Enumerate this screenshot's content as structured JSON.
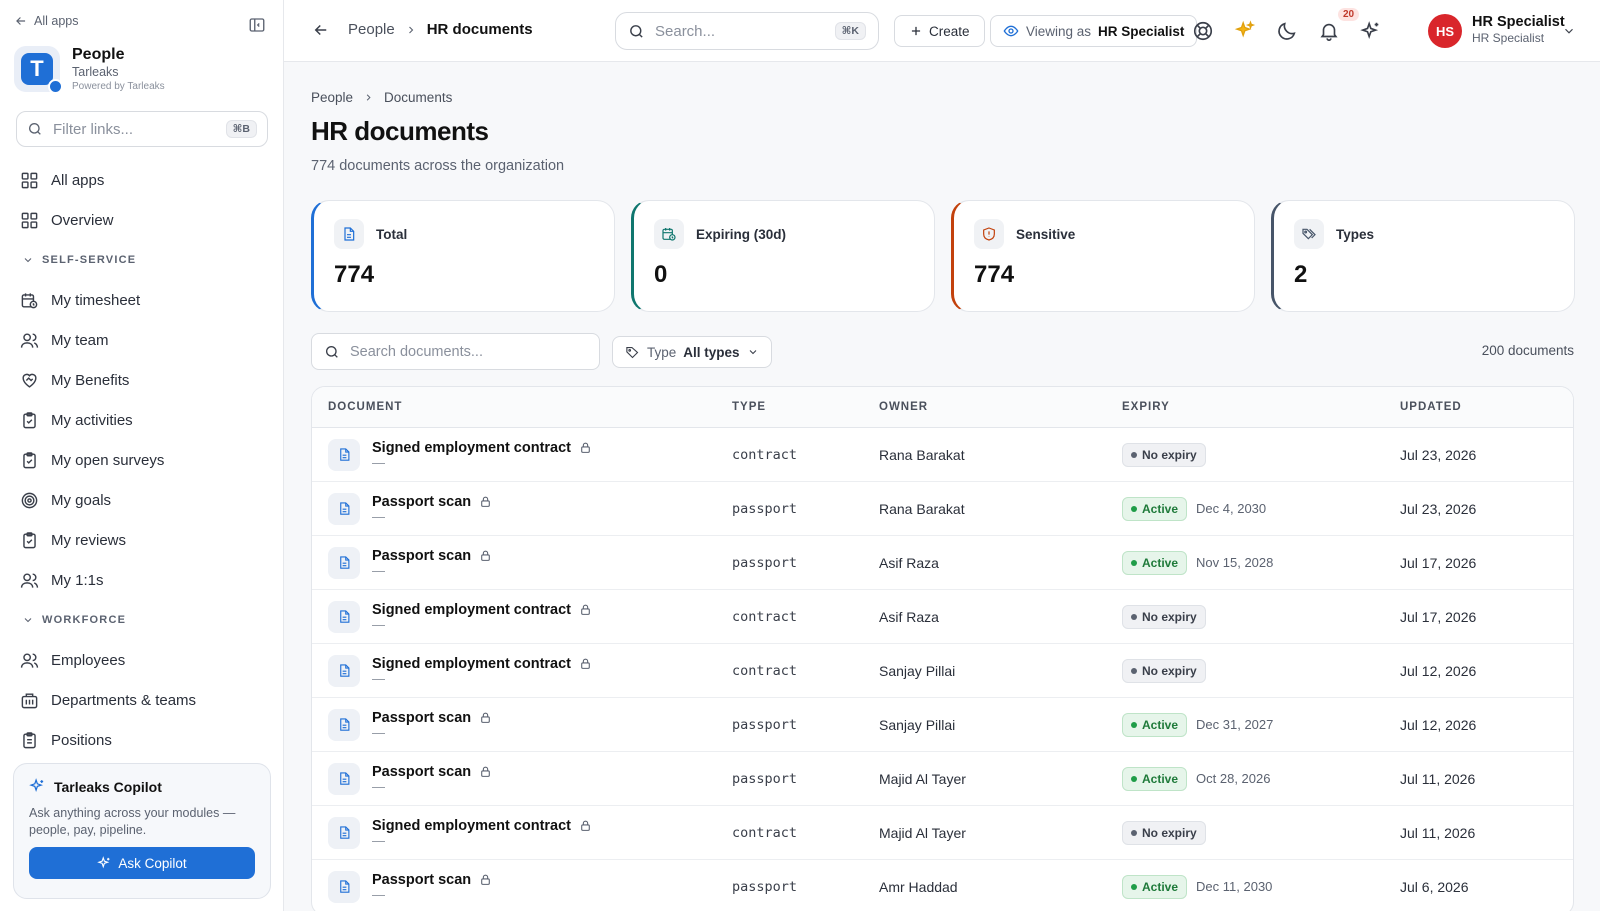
{
  "sidebar": {
    "back_label": "All apps",
    "brand": {
      "name": "People",
      "org": "Tarleaks",
      "powered": "Powered by Tarleaks",
      "logo_letter": "T"
    },
    "filter": {
      "placeholder": "Filter links...",
      "shortcut": "⌘B"
    },
    "top_items": [
      {
        "label": "All apps",
        "icon": "grid-icon"
      },
      {
        "label": "Overview",
        "icon": "grid-icon"
      }
    ],
    "sections": [
      {
        "title": "SELF-SERVICE",
        "items": [
          {
            "label": "My timesheet",
            "icon": "calendar-clock-icon"
          },
          {
            "label": "My team",
            "icon": "users-icon"
          },
          {
            "label": "My Benefits",
            "icon": "heart-handshake-icon"
          },
          {
            "label": "My activities",
            "icon": "clipboard-check-icon"
          },
          {
            "label": "My open surveys",
            "icon": "clipboard-check-icon"
          },
          {
            "label": "My goals",
            "icon": "target-icon"
          },
          {
            "label": "My reviews",
            "icon": "clipboard-check-icon"
          },
          {
            "label": "My 1:1s",
            "icon": "users-icon"
          }
        ]
      },
      {
        "title": "WORKFORCE",
        "items": [
          {
            "label": "Employees",
            "icon": "users-icon"
          },
          {
            "label": "Departments & teams",
            "icon": "building-icon"
          },
          {
            "label": "Positions",
            "icon": "clipboard-list-icon"
          }
        ]
      }
    ],
    "copilot": {
      "title": "Tarleaks Copilot",
      "description": "Ask anything across your modules — people, pay, pipeline.",
      "button": "Ask Copilot"
    }
  },
  "header": {
    "breadcrumb": [
      "People",
      "HR documents"
    ],
    "search": {
      "placeholder": "Search...",
      "shortcut": "⌘K"
    },
    "create_label": "Create",
    "viewing_prefix": "Viewing as",
    "viewing_role": "HR Specialist",
    "notifications_count": "20",
    "user": {
      "initials": "HS",
      "name": "HR Specialist",
      "role": "HR Specialist"
    }
  },
  "page": {
    "breadcrumb": [
      "People",
      "Documents"
    ],
    "title": "HR documents",
    "subtitle": "774 documents across the organization",
    "stats": [
      {
        "label": "Total",
        "value": "774",
        "icon": "file-text-icon",
        "accent": "#1f6fd6"
      },
      {
        "label": "Expiring (30d)",
        "value": "0",
        "icon": "calendar-clock-icon",
        "accent": "#0f766e"
      },
      {
        "label": "Sensitive",
        "value": "774",
        "icon": "shield-alert-icon",
        "accent": "#c2410c"
      },
      {
        "label": "Types",
        "value": "2",
        "icon": "tags-icon",
        "accent": "#475569"
      }
    ],
    "doc_search_placeholder": "Search documents...",
    "type_filter": {
      "label": "Type",
      "value": "All types"
    },
    "count_label": "200 documents",
    "columns": [
      "DOCUMENT",
      "TYPE",
      "OWNER",
      "EXPIRY",
      "UPDATED"
    ],
    "rows": [
      {
        "title": "Signed employment contract",
        "sub": "—",
        "type": "contract",
        "owner": "Rana Barakat",
        "status": "No expiry",
        "expiry": "",
        "updated": "Jul 23, 2026"
      },
      {
        "title": "Passport scan",
        "sub": "—",
        "type": "passport",
        "owner": "Rana Barakat",
        "status": "Active",
        "expiry": "Dec 4, 2030",
        "updated": "Jul 23, 2026"
      },
      {
        "title": "Passport scan",
        "sub": "—",
        "type": "passport",
        "owner": "Asif Raza",
        "status": "Active",
        "expiry": "Nov 15, 2028",
        "updated": "Jul 17, 2026"
      },
      {
        "title": "Signed employment contract",
        "sub": "—",
        "type": "contract",
        "owner": "Asif Raza",
        "status": "No expiry",
        "expiry": "",
        "updated": "Jul 17, 2026"
      },
      {
        "title": "Signed employment contract",
        "sub": "—",
        "type": "contract",
        "owner": "Sanjay Pillai",
        "status": "No expiry",
        "expiry": "",
        "updated": "Jul 12, 2026"
      },
      {
        "title": "Passport scan",
        "sub": "—",
        "type": "passport",
        "owner": "Sanjay Pillai",
        "status": "Active",
        "expiry": "Dec 31, 2027",
        "updated": "Jul 12, 2026"
      },
      {
        "title": "Passport scan",
        "sub": "—",
        "type": "passport",
        "owner": "Majid Al Tayer",
        "status": "Active",
        "expiry": "Oct 28, 2026",
        "updated": "Jul 11, 2026"
      },
      {
        "title": "Signed employment contract",
        "sub": "—",
        "type": "contract",
        "owner": "Majid Al Tayer",
        "status": "No expiry",
        "expiry": "",
        "updated": "Jul 11, 2026"
      },
      {
        "title": "Passport scan",
        "sub": "—",
        "type": "passport",
        "owner": "Amr Haddad",
        "status": "Active",
        "expiry": "Dec 11, 2030",
        "updated": "Jul 6, 2026"
      }
    ]
  }
}
